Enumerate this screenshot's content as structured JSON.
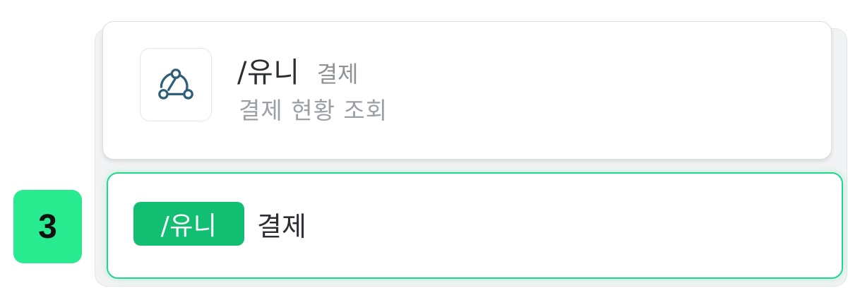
{
  "suggestion": {
    "icon": "webhook-icon",
    "command": "/유니",
    "argument": "결제",
    "description": "결제 현황 조회"
  },
  "input": {
    "command_chip": "/유니",
    "text": "결제"
  },
  "step_badge": "3",
  "colors": {
    "accent_green": "#12bf72",
    "focus_border": "#1fd88b",
    "badge_green": "#28ea8f",
    "icon_blue": "#2f5f78"
  }
}
